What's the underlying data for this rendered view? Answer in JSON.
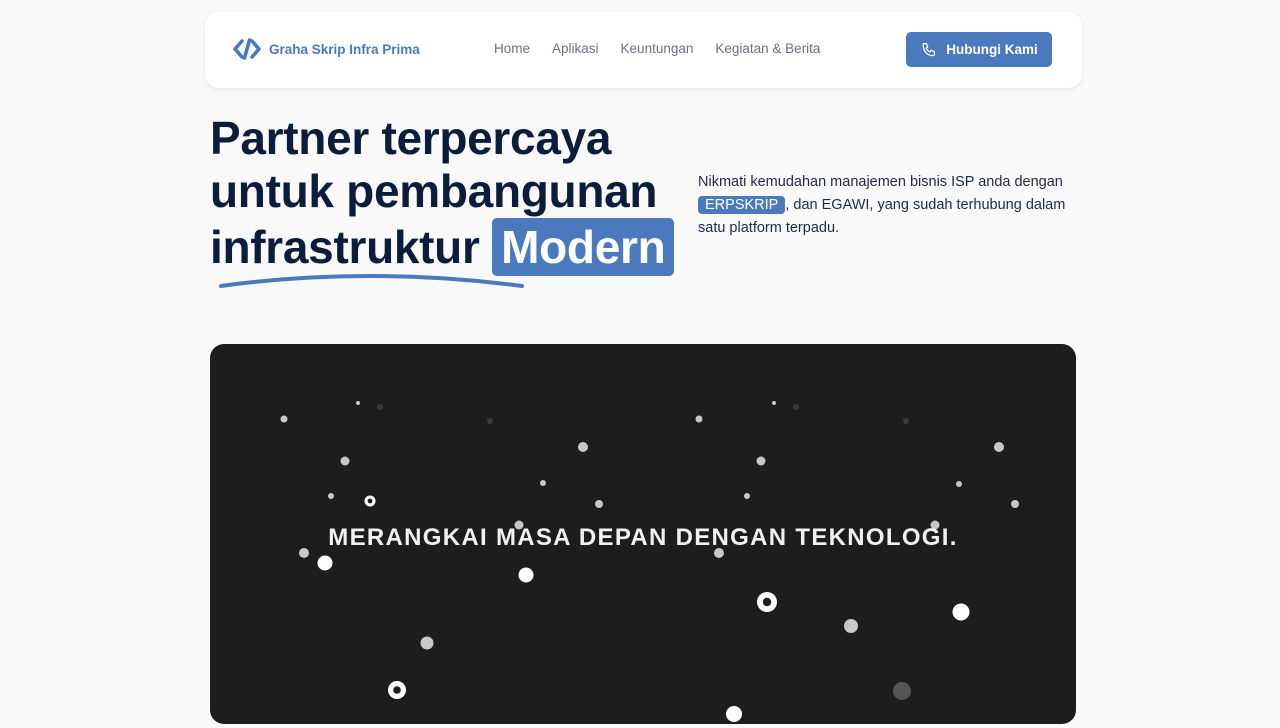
{
  "nav": {
    "brand": "Graha Skrip Infra Prima",
    "links": [
      "Home",
      "Aplikasi",
      "Keuntungan",
      "Kegiatan & Berita"
    ],
    "cta_label": "Hubungi Kami",
    "icons": {
      "brand": "code-logo-icon",
      "cta": "phone-icon"
    }
  },
  "hero": {
    "title_line1": "Partner terpercaya",
    "title_line2": "untuk pembangunan",
    "title_line3": "infrastruktur",
    "title_highlight": "Modern",
    "desc_before": "Nikmati kemudahan manajemen bisnis ISP anda dengan",
    "desc_pill": "ERPSKRIP",
    "desc_after": ", dan EGAWI, yang sudah terhubung dalam satu platform terpadu."
  },
  "banner": {
    "text": "MERANGKAI MASA DEPAN DENGAN TEKNOLOGI."
  },
  "colors": {
    "accent": "#4a7abd",
    "heading": "#0b1d3d",
    "page_bg": "#f9f9f9",
    "banner_bg": "#1d1d1d"
  }
}
